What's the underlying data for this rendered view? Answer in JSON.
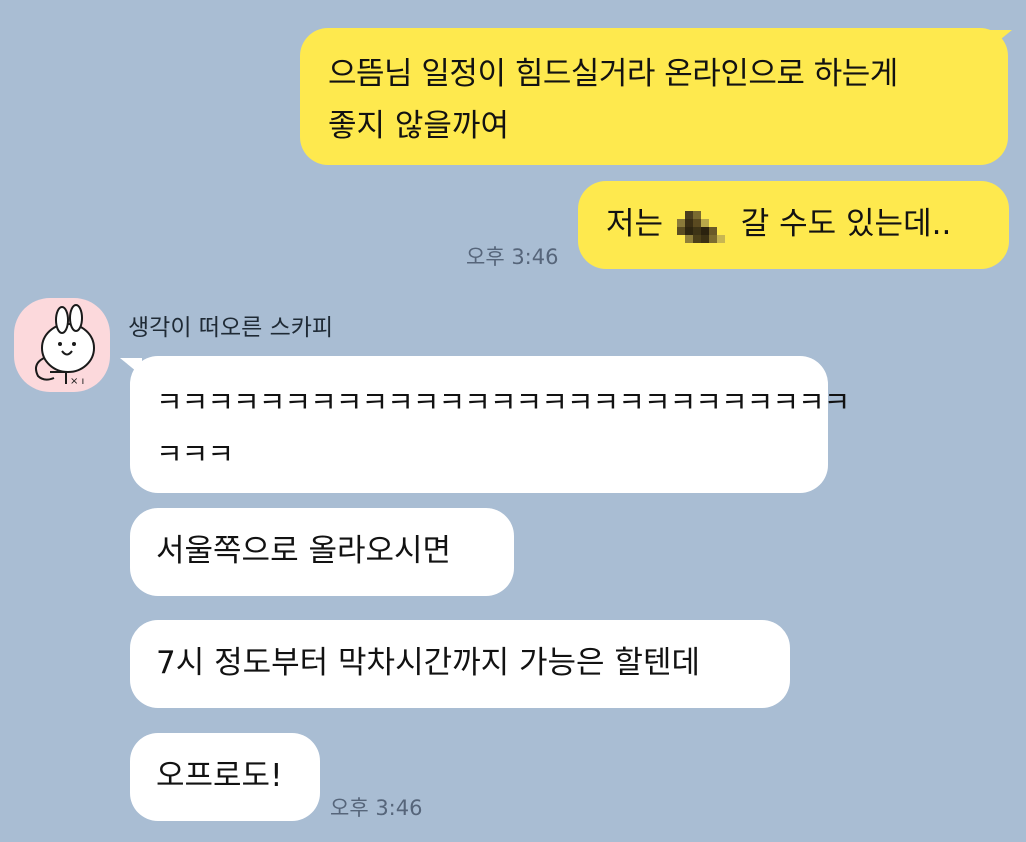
{
  "chat": {
    "sent": {
      "message1_line1": "으뜸님 일정이 힘드실거라 온라인으로 하는게",
      "message1_line2": "좋지 않을까여",
      "message2_before": "저는",
      "message2_after": "갈 수도 있는데..",
      "time": "오후 3:46"
    },
    "received": {
      "sender_name": "생각이 떠오른 스카피",
      "message1_line1": "ㅋㅋㅋㅋㅋㅋㅋㅋㅋㅋㅋㅋㅋㅋㅋㅋㅋㅋㅋㅋㅋㅋㅋㅋㅋㅋㅋ",
      "message1_line2": "ㅋㅋㅋ",
      "message2": "서울쪽으로 올라오시면",
      "message3": "7시 정도부터 막차시간까지 가능은 할텐데",
      "message4": "오프로도!",
      "time": "오후 3:46"
    }
  },
  "colors": {
    "background": "#a9bdd3",
    "my_bubble": "#fee94e",
    "their_bubble": "#ffffff",
    "avatar_bg": "#fcd9dc"
  },
  "icons": {
    "avatar": "bunny-character-icon",
    "redacted": "pixelated-mosaic"
  }
}
